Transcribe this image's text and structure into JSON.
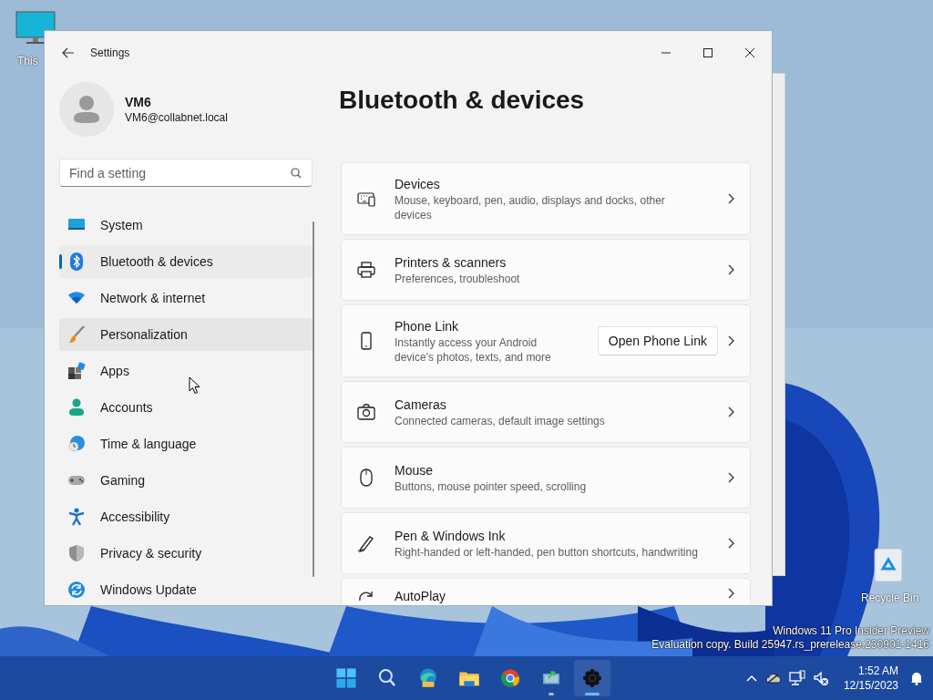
{
  "desktop": {
    "icons": [
      {
        "label": "This"
      },
      {
        "label": "Recycle Bin"
      }
    ],
    "watermark": [
      "Windows 11 Pro Insider Preview",
      "Evaluation copy. Build 25947.rs_prerelease.230901-1416"
    ]
  },
  "window": {
    "title": "Settings"
  },
  "account": {
    "name": "VM6",
    "email": "VM6@collabnet.local"
  },
  "search": {
    "placeholder": "Find a setting"
  },
  "nav": [
    {
      "label": "System",
      "selected": false,
      "hovered": false
    },
    {
      "label": "Bluetooth & devices",
      "selected": true,
      "hovered": false
    },
    {
      "label": "Network & internet",
      "selected": false,
      "hovered": false
    },
    {
      "label": "Personalization",
      "selected": false,
      "hovered": true
    },
    {
      "label": "Apps",
      "selected": false,
      "hovered": false
    },
    {
      "label": "Accounts",
      "selected": false,
      "hovered": false
    },
    {
      "label": "Time & language",
      "selected": false,
      "hovered": false
    },
    {
      "label": "Gaming",
      "selected": false,
      "hovered": false
    },
    {
      "label": "Accessibility",
      "selected": false,
      "hovered": false
    },
    {
      "label": "Privacy & security",
      "selected": false,
      "hovered": false
    },
    {
      "label": "Windows Update",
      "selected": false,
      "hovered": false
    }
  ],
  "page": {
    "title": "Bluetooth & devices",
    "cards": [
      {
        "title": "Devices",
        "description": "Mouse, keyboard, pen, audio, displays and docks, other\ndevices"
      },
      {
        "title": "Printers & scanners",
        "description": "Preferences, troubleshoot"
      },
      {
        "title": "Phone Link",
        "description": "Instantly access your Android\ndevice's photos, texts, and more",
        "button": "Open Phone Link"
      },
      {
        "title": "Cameras",
        "description": "Connected cameras, default image settings"
      },
      {
        "title": "Mouse",
        "description": "Buttons, mouse pointer speed, scrolling"
      },
      {
        "title": "Pen & Windows Ink",
        "description": "Right-handed or left-handed, pen button shortcuts, handwriting"
      },
      {
        "title": "AutoPlay"
      }
    ]
  },
  "taskbar": {
    "apps": [
      {
        "selected": false,
        "running": false
      },
      {
        "selected": false,
        "running": false
      },
      {
        "selected": false,
        "running": false
      },
      {
        "selected": false,
        "running": false
      },
      {
        "selected": false,
        "running": false
      },
      {
        "selected": false,
        "running": true
      },
      {
        "selected": true,
        "running": true
      }
    ],
    "clock": {
      "time": "1:52 AM",
      "date": "12/15/2023"
    }
  }
}
